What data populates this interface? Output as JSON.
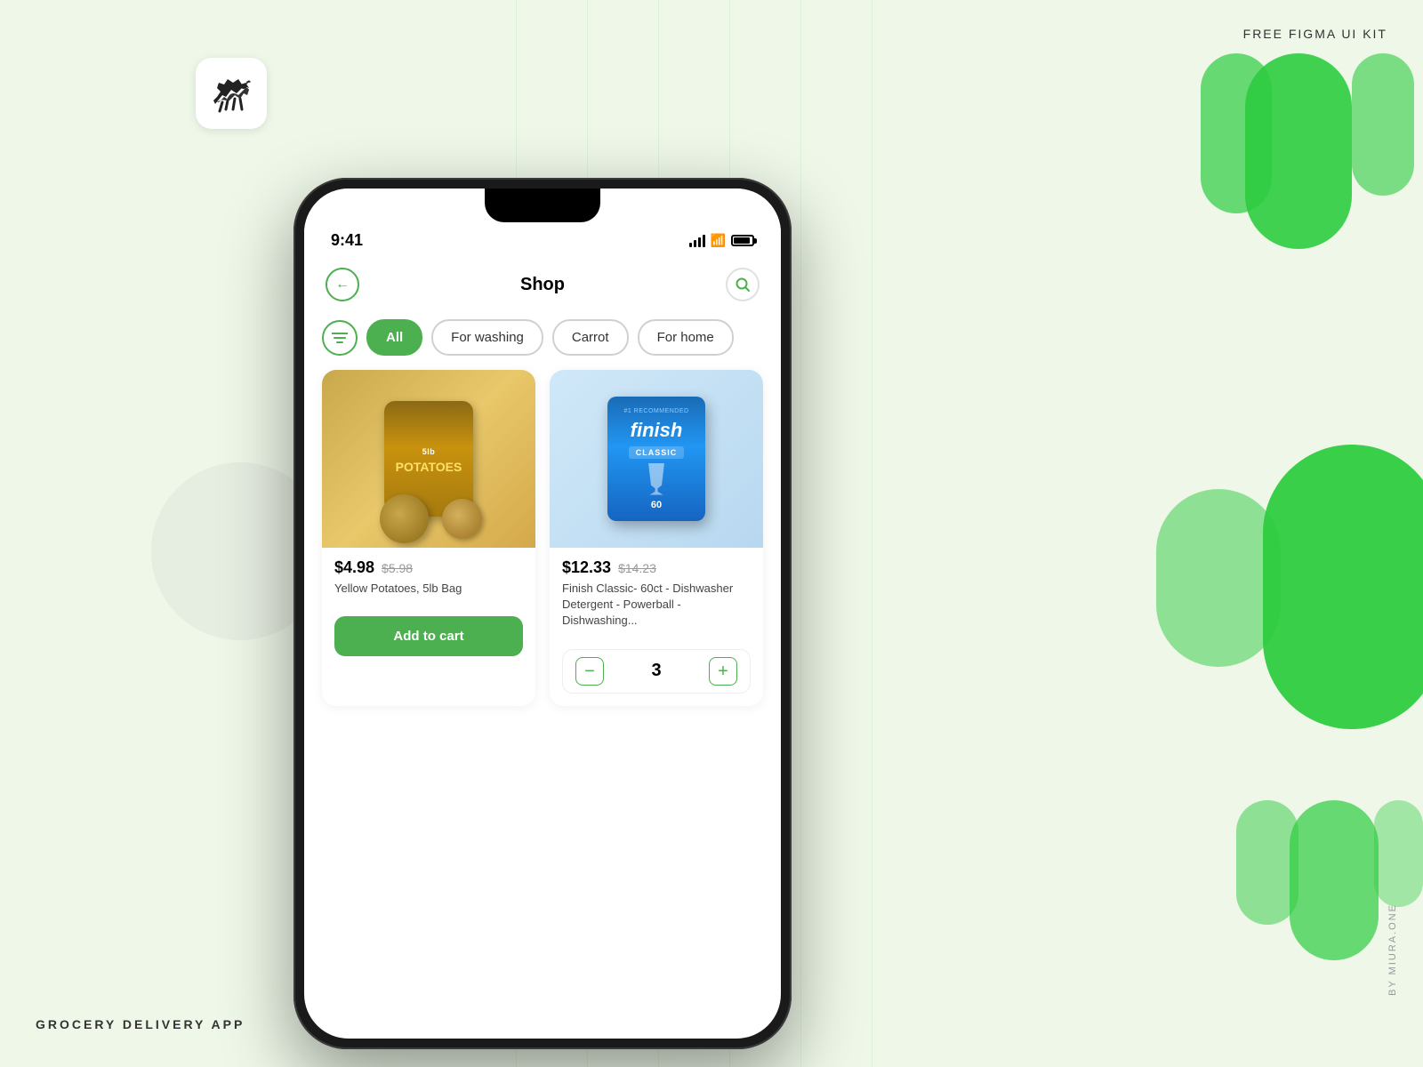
{
  "page": {
    "top_label": "FREE FIGMA UI KIT",
    "bottom_label": "GROCERY DELIVERY APP",
    "side_label": "BY MIURA.ONE"
  },
  "status_bar": {
    "time": "9:41",
    "signal": "●●●●",
    "wifi": "WiFi",
    "battery": "Battery"
  },
  "app": {
    "title": "Shop",
    "back_button_label": "←",
    "search_button_label": "🔍"
  },
  "filters": {
    "icon_label": "≡",
    "chips": [
      {
        "label": "All",
        "active": true
      },
      {
        "label": "For washing",
        "active": false
      },
      {
        "label": "Carrot",
        "active": false
      },
      {
        "label": "For home",
        "active": false
      }
    ]
  },
  "products": [
    {
      "id": "product-1",
      "name": "Yellow Potatoes, 5lb Bag",
      "price": "$4.98",
      "old_price": "$5.98",
      "action": "Add to cart",
      "image_type": "potato"
    },
    {
      "id": "product-2",
      "name": "Finish Classic- 60ct - Dishwasher Detergent - Powerball - Dishwashing...",
      "price": "$12.33",
      "old_price": "$14.23",
      "quantity": "3",
      "image_type": "finish"
    }
  ],
  "stepper": {
    "minus_label": "−",
    "plus_label": "+"
  }
}
